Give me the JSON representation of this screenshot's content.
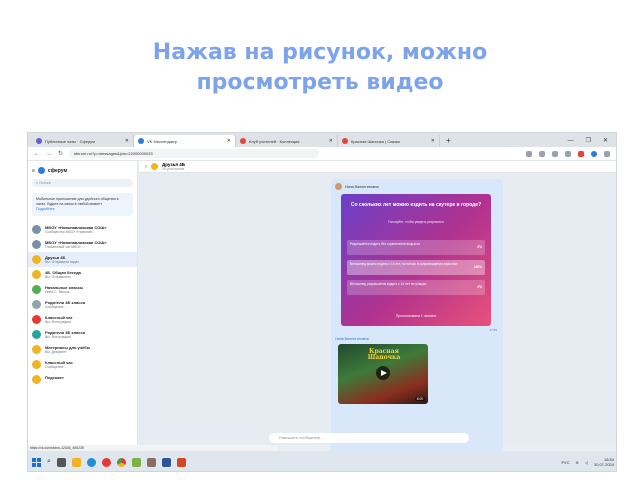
{
  "slide": {
    "title_line1": "Нажав на рисунок, можно",
    "title_line2": "просмотреть видео"
  },
  "browser": {
    "tabs": [
      {
        "label": "Публичные чаты · Сферум",
        "color": "#6b5bd6",
        "active": false
      },
      {
        "label": "VK Мессенджер",
        "color": "#2b7ae0",
        "active": true
      },
      {
        "label": "Клуб учителей · Коллекция",
        "color": "#e0463a",
        "active": false
      },
      {
        "label": "Красная Шапочка | Сказки",
        "color": "#e0463a",
        "active": false
      }
    ],
    "url": "sferum.ru/?p=messages&join=22000000015"
  },
  "sidebar": {
    "brand": "сферум",
    "search_placeholder": "Поиск",
    "notice_text": "Мобильное приложение для удобного общения в чатах. Будьте на связи в любой момент",
    "notice_link": "Подробнее",
    "chats": [
      {
        "title": "МБОУ «Новопавловская СОШ»",
        "preview": "Сообщество МБОУ «Новопав…",
        "color": "#7b8fa6"
      },
      {
        "title": "МБОУ «Новопавловская СОШ»",
        "preview": "Глобальный чат МБОУ…",
        "color": "#7b8fa6"
      },
      {
        "title": "Друзья 4Б",
        "preview": "Вы: Отправили видео",
        "color": "#f0b323"
      },
      {
        "title": "4Б. Общая беседа",
        "preview": "Вы: Отправлено",
        "color": "#f0b323"
      },
      {
        "title": "Начальные классы",
        "preview": "Нина С. Звонок",
        "color": "#4caf50"
      },
      {
        "title": "Родители 4Б класса",
        "preview": "Сообщение…",
        "color": "#90a4ae"
      },
      {
        "title": "Классный чат",
        "preview": "Вы: Фотография",
        "color": "#e53935"
      },
      {
        "title": "Родители 3Б класса",
        "preview": "Вы: Фотография",
        "color": "#26a69a"
      },
      {
        "title": "Материалы для учёбы",
        "preview": "Вы: Документ",
        "color": "#f0b323"
      },
      {
        "title": "Классный час",
        "preview": "Сообщение…",
        "color": "#f0b323"
      },
      {
        "title": "Педсовет",
        "preview": "…",
        "color": "#f0b323"
      }
    ]
  },
  "chat": {
    "title": "Друзья 4Б",
    "subtitle": "35 участников",
    "poll_sender": "Нина Валентиновна",
    "poll_question": "Со скольких лет можно ездить на скутере в городе?",
    "poll_note": "Голосуйте, чтобы увидеть результаты",
    "poll_options": [
      {
        "text": "Разрешается ездить без ограничения возраста",
        "pct": "0%"
      },
      {
        "text": "Велосипед можно водить с 14 лет, но только в сопровождении взрослых",
        "pct": "100%"
      },
      {
        "text": "Велосипед разрешается водить с 14 лет по улицам",
        "pct": "0%"
      }
    ],
    "poll_votes": "Проголосовали 1 человек",
    "poll_time": "17:59",
    "video_sender": "Нина Валентиновна",
    "video_title": "Красная Шапочка",
    "video_duration": "8:05",
    "composer_placeholder": "Напишите сообщение…"
  },
  "status_url": "https://vk.com/video-12345_456239",
  "taskbar": {
    "time": "18:54",
    "date": "30.07.2024",
    "lang": "РУС"
  }
}
